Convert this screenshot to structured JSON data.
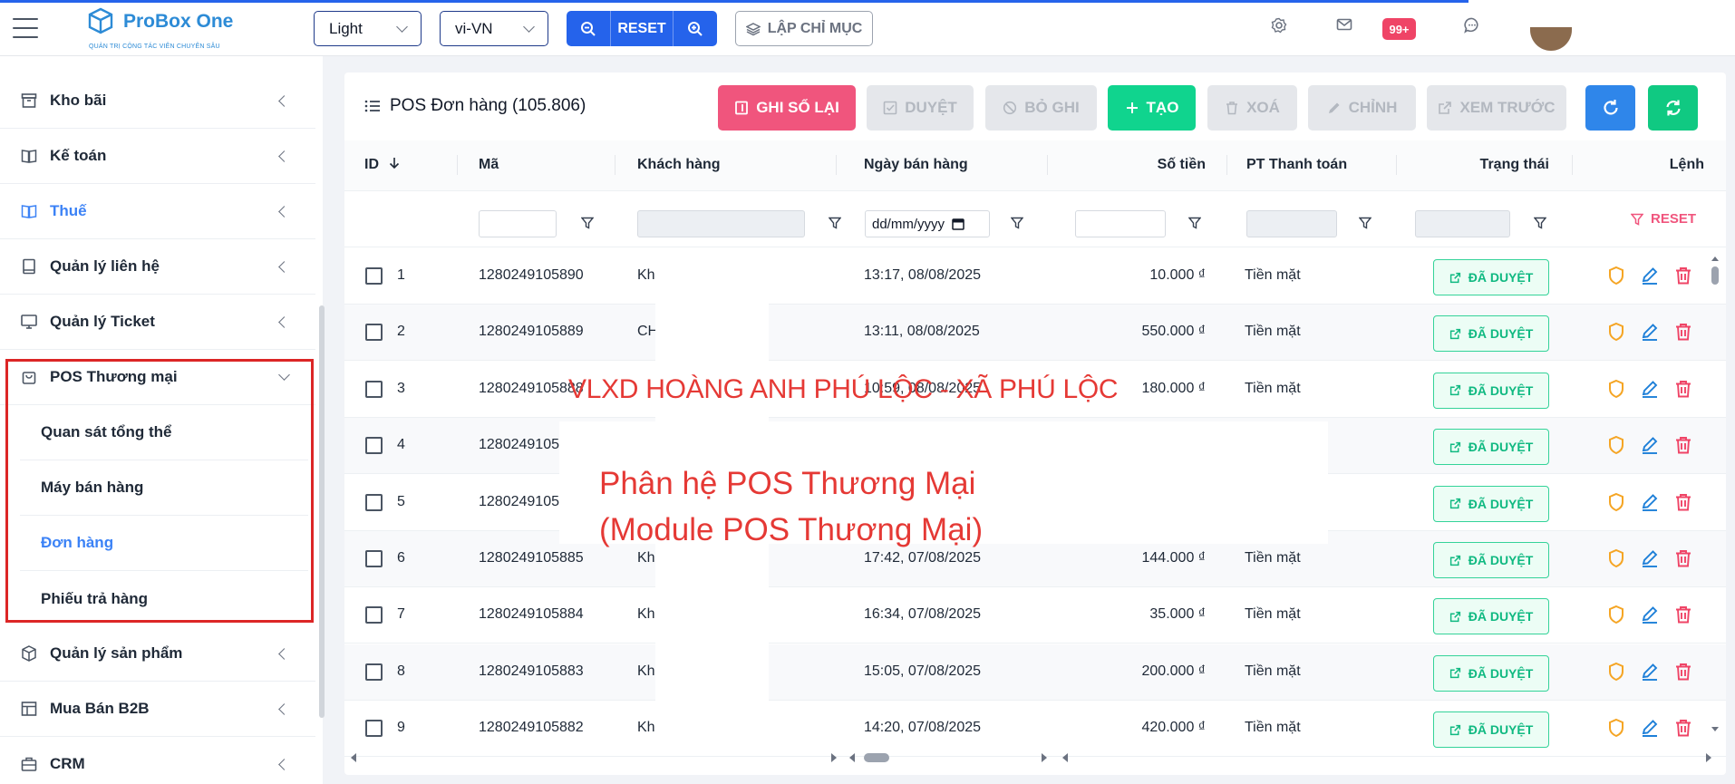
{
  "header": {
    "brand": "ProBox One",
    "brand_sub": "QUẢN TRỊ CỘNG TÁC VIÊN CHUYÊN SÂU",
    "theme_value": "Light",
    "lang_value": "vi-VN",
    "reset_label": "RESET",
    "index_label": "LẬP CHỈ MỤC",
    "notif_badge": "99+",
    "accent": "#2563eb"
  },
  "sidebar": {
    "items": [
      {
        "label": "Kho bãi",
        "icon": "archive-icon"
      },
      {
        "label": "Kế toán",
        "icon": "book-icon"
      },
      {
        "label": "Thuế",
        "icon": "book-open-icon"
      },
      {
        "label": "Quản lý liên hệ",
        "icon": "contact-book-icon"
      },
      {
        "label": "Quản lý Ticket",
        "icon": "monitor-icon"
      },
      {
        "label": "POS Thương mại",
        "icon": "shopping-bag-icon"
      },
      {
        "label": "Quản lý sản phẩm",
        "icon": "box-icon"
      },
      {
        "label": "Mua Bán B2B",
        "icon": "table-icon"
      },
      {
        "label": "CRM",
        "icon": "briefcase-icon"
      }
    ],
    "pos_sub": [
      "Quan sát tổng thể",
      "Máy bán hàng",
      "Đơn hàng",
      "Phiếu trả hàng"
    ]
  },
  "main": {
    "title": "POS Đơn hàng (105.806)",
    "buttons": {
      "ghi_so_lai": "GHI SỔ LẠI",
      "duyet": "DUYỆT",
      "bo_ghi": "BỎ GHI",
      "tao": "TẠO",
      "xoa": "XOÁ",
      "chinh": "CHỈNH",
      "xem_truoc": "XEM TRƯỚC"
    },
    "columns": {
      "id": "ID",
      "ma": "Mã",
      "khach_hang": "Khách hàng",
      "ngay_ban": "Ngày bán hàng",
      "so_tien": "Số tiền",
      "pt_thanh_toan": "PT Thanh toán",
      "trang_thai": "Trạng thái",
      "lenh": "Lệnh"
    },
    "filter": {
      "date_placeholder": "dd/mm/yyyy",
      "reset_label": "RESET"
    },
    "rows": [
      {
        "id": "1",
        "ma": "1280249105890",
        "kh": "Kh",
        "ngay": "13:17, 08/08/2025",
        "tien": "10.000 ₫",
        "pt": "Tiền mặt",
        "tt": "ĐÃ DUYỆT"
      },
      {
        "id": "2",
        "ma": "1280249105889",
        "kh": "CH",
        "ngay": "13:11, 08/08/2025",
        "tien": "550.000 ₫",
        "pt": "Tiền mặt",
        "tt": "ĐÃ DUYỆT"
      },
      {
        "id": "3",
        "ma": "1280249105888",
        "kh": "",
        "ngay": "10:59, 08/08/2025",
        "tien": "180.000 ₫",
        "pt": "Tiền mặt",
        "tt": "ĐÃ DUYỆT"
      },
      {
        "id": "4",
        "ma": "1280249105",
        "kh": "",
        "ngay": "",
        "tien": "",
        "pt": "",
        "tt": "ĐÃ DUYỆT"
      },
      {
        "id": "5",
        "ma": "1280249105",
        "kh": "",
        "ngay": "",
        "tien": "",
        "pt": "",
        "tt": "ĐÃ DUYỆT"
      },
      {
        "id": "6",
        "ma": "1280249105885",
        "kh": "Kh",
        "ngay": "17:42, 07/08/2025",
        "tien": "144.000 ₫",
        "pt": "Tiền mặt",
        "tt": "ĐÃ DUYỆT"
      },
      {
        "id": "7",
        "ma": "1280249105884",
        "kh": "Kh",
        "ngay": "16:34, 07/08/2025",
        "tien": "35.000 ₫",
        "pt": "Tiền mặt",
        "tt": "ĐÃ DUYỆT"
      },
      {
        "id": "8",
        "ma": "1280249105883",
        "kh": "Kh",
        "ngay": "15:05, 07/08/2025",
        "tien": "200.000 ₫",
        "pt": "Tiền mặt",
        "tt": "ĐÃ DUYỆT"
      },
      {
        "id": "9",
        "ma": "1280249105882",
        "kh": "Kh",
        "ngay": "14:20, 07/08/2025",
        "tien": "420.000 ₫",
        "pt": "Tiền mặt",
        "tt": "ĐÃ DUYỆT"
      }
    ]
  },
  "overlay": {
    "line1": "VLXD HOÀNG ANH PHÚ LỘC - XÃ PHÚ LỘC",
    "line2": "Phân hệ POS Thương Mại",
    "line3": "(Module POS Thương Mại)"
  }
}
